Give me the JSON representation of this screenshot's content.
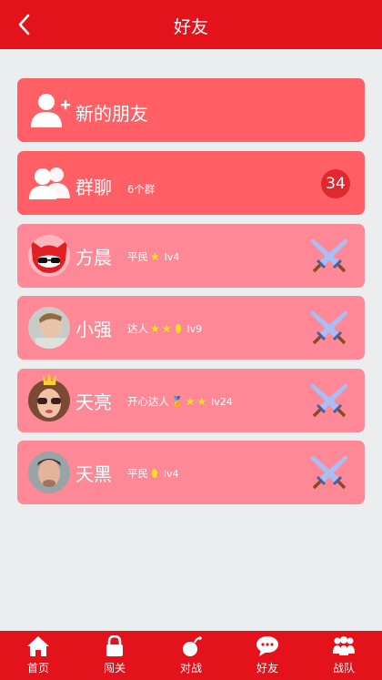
{
  "header": {
    "title": "好友"
  },
  "new_friends": {
    "label": "新的朋友"
  },
  "group_chat": {
    "label": "群聊",
    "sub": "6个群",
    "count": "34"
  },
  "friends": [
    {
      "name": "方晨",
      "rank": "平民",
      "stars": 1,
      "coins": 0,
      "medal": false,
      "level": "lv4"
    },
    {
      "name": "小强",
      "rank": "达人",
      "stars": 2,
      "coins": 1,
      "medal": false,
      "level": "lv9"
    },
    {
      "name": "天亮",
      "rank": "开心达人",
      "stars": 2,
      "coins": 0,
      "medal": true,
      "level": "lv24"
    },
    {
      "name": "天黑",
      "rank": "平民",
      "stars": 0,
      "coins": 1,
      "medal": false,
      "level": "lv4"
    }
  ],
  "tabs": [
    {
      "label": "首页",
      "icon": "home-icon"
    },
    {
      "label": "闯关",
      "icon": "lock-icon"
    },
    {
      "label": "对战",
      "icon": "bomb-icon"
    },
    {
      "label": "好友",
      "icon": "chat-icon"
    },
    {
      "label": "战队",
      "icon": "team-icon"
    }
  ],
  "colors": {
    "primary": "#e3121b",
    "row_red": "#ff5f65",
    "row_pink": "#ff8896",
    "badge": "#e0282f",
    "star": "#ffe21a"
  }
}
